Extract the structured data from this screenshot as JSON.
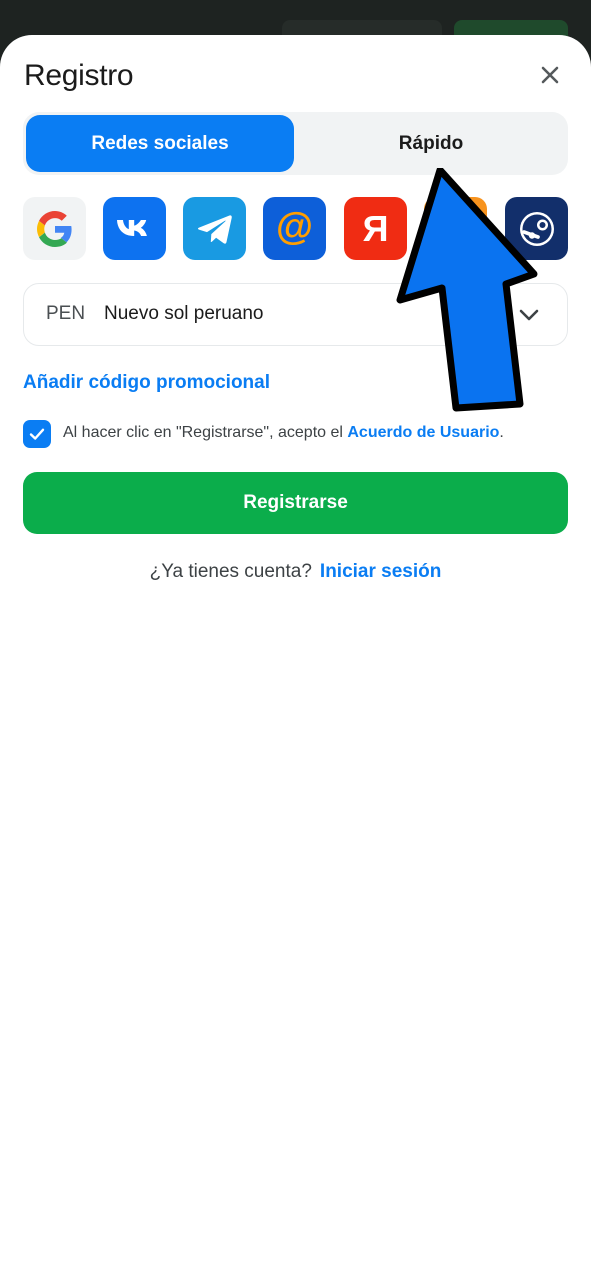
{
  "dialog": {
    "title": "Registro"
  },
  "tabs": [
    {
      "label": "Redes sociales",
      "active": true
    },
    {
      "label": "Rápido",
      "active": false
    }
  ],
  "social_providers": [
    {
      "name": "Google",
      "icon": "google-icon"
    },
    {
      "name": "VK",
      "icon": "vk-icon"
    },
    {
      "name": "Telegram",
      "icon": "telegram-icon"
    },
    {
      "name": "Mail.ru",
      "icon": "mail-at-icon",
      "glyph": "@"
    },
    {
      "name": "Yandex",
      "icon": "yandex-icon",
      "glyph": "Я"
    },
    {
      "name": "Odnoklassniki",
      "icon": "ok-icon"
    },
    {
      "name": "Steam",
      "icon": "steam-icon"
    }
  ],
  "currency": {
    "code": "PEN",
    "name": "Nuevo sol peruano"
  },
  "promo_link": "Añadir código promocional",
  "agreement": {
    "checked": true,
    "text": "Al hacer clic en \"Registrarse\", acepto el ",
    "link": "Acuerdo de Usuario",
    "suffix": "."
  },
  "register_button": "Registrarse",
  "login_prompt": {
    "text": "¿Ya tienes cuenta?",
    "link": "Iniciar sesión"
  },
  "colors": {
    "accent": "#0a7df3",
    "register": "#0bad4b",
    "overlay_arrow": "#0a73f0"
  }
}
